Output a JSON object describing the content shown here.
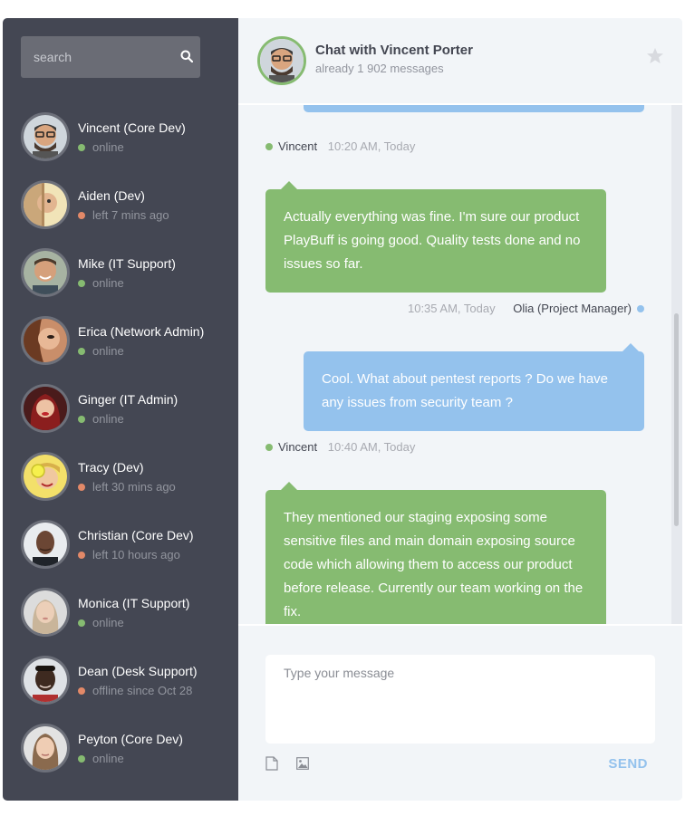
{
  "sidebar": {
    "search_placeholder": "search",
    "contacts": [
      {
        "name": "Vincent (Core Dev)",
        "status": "online",
        "state": "online"
      },
      {
        "name": "Aiden (Dev)",
        "status": "left 7 mins ago",
        "state": "away"
      },
      {
        "name": "Mike (IT Support)",
        "status": "online",
        "state": "online"
      },
      {
        "name": "Erica (Network Admin)",
        "status": "online",
        "state": "online"
      },
      {
        "name": "Ginger (IT Admin)",
        "status": "online",
        "state": "online"
      },
      {
        "name": "Tracy (Dev)",
        "status": "left 30 mins ago",
        "state": "away"
      },
      {
        "name": "Christian (Core Dev)",
        "status": "left 10 hours ago",
        "state": "away"
      },
      {
        "name": "Monica (IT Support)",
        "status": "online",
        "state": "online"
      },
      {
        "name": "Dean (Desk Support)",
        "status": "offline since Oct 28",
        "state": "away"
      },
      {
        "name": "Peyton (Core Dev)",
        "status": "online",
        "state": "online"
      }
    ]
  },
  "chat": {
    "title": "Chat with Vincent Porter",
    "subtitle": "already 1 902 messages",
    "messages": [
      {
        "sender": "Vincent",
        "time": "10:20 AM, Today",
        "text": "Actually everything was fine. I'm sure our product PlayBuff is going good. Quality tests done and no issues so far."
      },
      {
        "sender": "Olia (Project Manager)",
        "time": "10:35 AM, Today",
        "text": "Cool. What about pentest reports ? Do we have any issues from security team ?"
      },
      {
        "sender": "Vincent",
        "time": "10:40 AM, Today",
        "text": "They mentioned our staging exposing some sensitive files and main domain exposing source code which allowing them to access our product before release. Currently our team working on the fix."
      }
    ],
    "composer": {
      "placeholder": "Type your message",
      "send_label": "SEND"
    }
  },
  "colors": {
    "sidebar_bg": "#444753",
    "online": "#86bb71",
    "away": "#e38968",
    "incoming_bubble": "#86bb71",
    "outgoing_bubble": "#94c2ed",
    "chat_bg": "#f2f5f8"
  }
}
